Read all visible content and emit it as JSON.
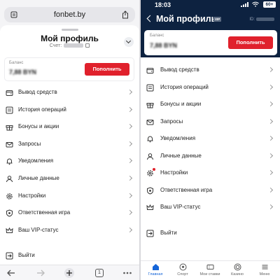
{
  "left": {
    "url": "fonbet.by",
    "title": "Мой профиль",
    "account_label": "Счет:",
    "balance_label": "Баланс",
    "balance_value": "7,88 BYN",
    "topup_label": "Пополнить",
    "menu": [
      {
        "label": "Вывод средств",
        "icon": "wallet-icon"
      },
      {
        "label": "История операций",
        "icon": "history-icon"
      },
      {
        "label": "Бонусы и акции",
        "icon": "gift-icon"
      },
      {
        "label": "Запросы",
        "icon": "mail-icon"
      },
      {
        "label": "Уведомления",
        "icon": "bell-icon"
      },
      {
        "label": "Личные данные",
        "icon": "user-icon"
      },
      {
        "label": "Настройки",
        "icon": "gear-icon"
      },
      {
        "label": "Ответственная игра",
        "icon": "shield-icon"
      },
      {
        "label": "Ваш VIP-статус",
        "icon": "crown-icon"
      }
    ],
    "logout_label": "Выйти",
    "page_count": "1"
  },
  "right": {
    "time": "18:03",
    "battery": "60+",
    "title": "Мой профиль",
    "vip_badge": "VIP",
    "id_label": "ID:",
    "balance_label": "Баланс",
    "balance_value": "7,88 BYN",
    "topup_label": "Пополнить",
    "menu": [
      {
        "label": "Вывод средств",
        "icon": "wallet-icon"
      },
      {
        "label": "История операций",
        "icon": "history-icon"
      },
      {
        "label": "Бонусы и акции",
        "icon": "gift-icon"
      },
      {
        "label": "Запросы",
        "icon": "mail-icon"
      },
      {
        "label": "Уведомления",
        "icon": "bell-icon"
      },
      {
        "label": "Личные данные",
        "icon": "user-icon"
      },
      {
        "label": "Настройки",
        "icon": "gear-icon"
      },
      {
        "label": "Ответственная игра",
        "icon": "shield-icon"
      },
      {
        "label": "Ваш VIP-статус",
        "icon": "crown-icon"
      }
    ],
    "logout_label": "Выйти",
    "tabs": [
      {
        "label": "Главная",
        "icon": "home-icon",
        "active": true
      },
      {
        "label": "Спорт",
        "icon": "ball-icon",
        "active": false
      },
      {
        "label": "Мои ставки",
        "icon": "ticket-icon",
        "active": false
      },
      {
        "label": "Казино",
        "icon": "chip-icon",
        "active": false
      },
      {
        "label": "Меню",
        "icon": "menu-icon",
        "active": false
      }
    ]
  },
  "colors": {
    "accent_red": "#e0212c",
    "app_navy": "#0d2240",
    "tab_active": "#1565d8"
  }
}
